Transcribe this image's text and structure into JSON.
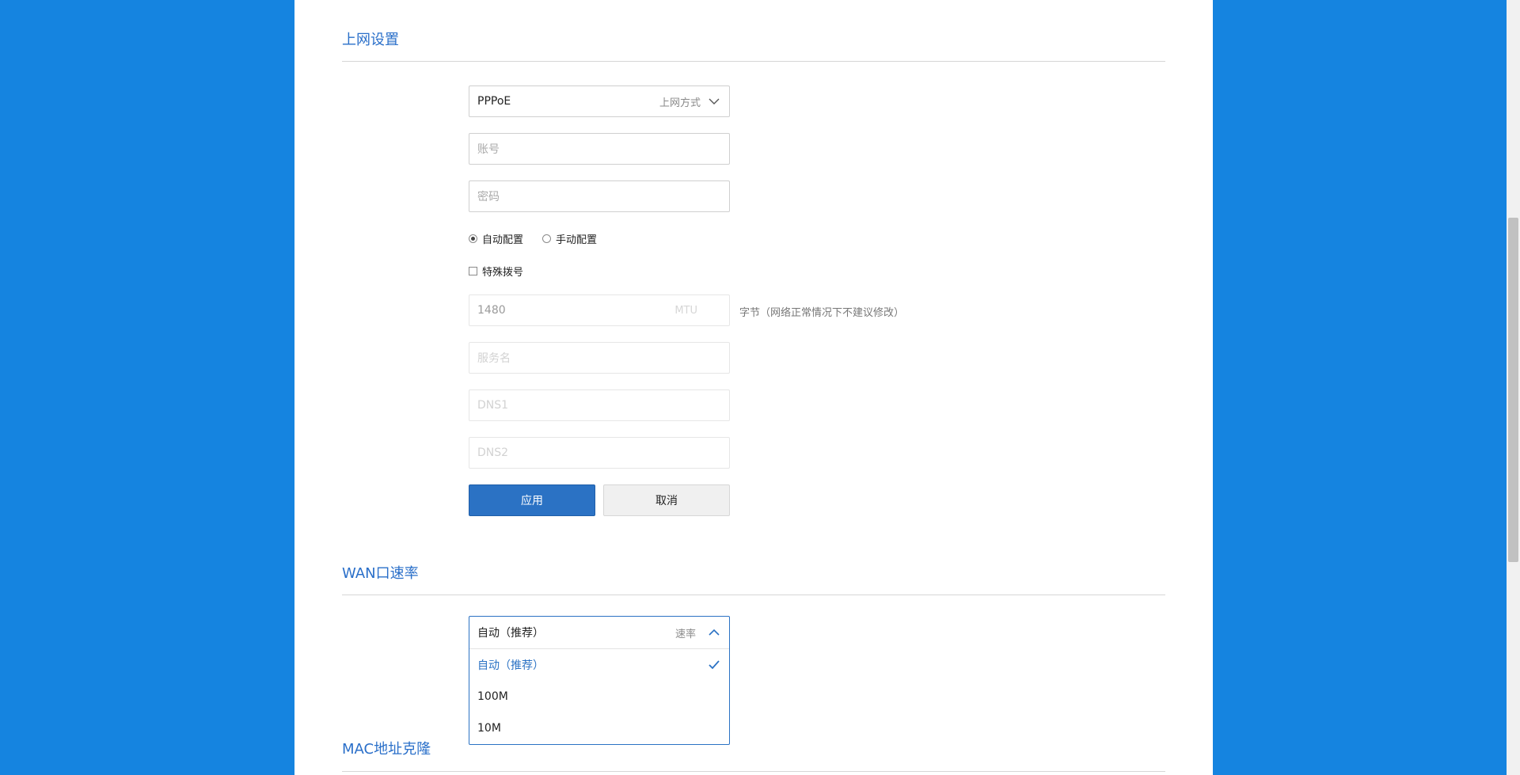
{
  "internet": {
    "title": "上网设置",
    "mode": {
      "value": "PPPoE",
      "label": "上网方式"
    },
    "account": {
      "placeholder": "账号"
    },
    "password": {
      "placeholder": "密码"
    },
    "config": {
      "auto_label": "自动配置",
      "manual_label": "手动配置",
      "selected": "auto"
    },
    "special_dial": {
      "label": "特殊拨号",
      "checked": false
    },
    "mtu": {
      "value": "1480",
      "label": "MTU",
      "hint": "字节（网络正常情况下不建议修改）"
    },
    "service_name": {
      "placeholder": "服务名"
    },
    "dns1": {
      "placeholder": "DNS1"
    },
    "dns2": {
      "placeholder": "DNS2"
    },
    "apply_label": "应用",
    "cancel_label": "取消"
  },
  "wan": {
    "title": "WAN口速率",
    "speed": {
      "value": "自动（推荐）",
      "label": "速率",
      "options": [
        {
          "label": "自动（推荐）",
          "selected": true
        },
        {
          "label": "100M",
          "selected": false
        },
        {
          "label": "10M",
          "selected": false
        }
      ]
    }
  },
  "mac": {
    "title": "MAC地址克隆"
  },
  "colors": {
    "background": "#1584e0",
    "accent": "#2b72c4",
    "section_title": "#2a6fc9"
  }
}
